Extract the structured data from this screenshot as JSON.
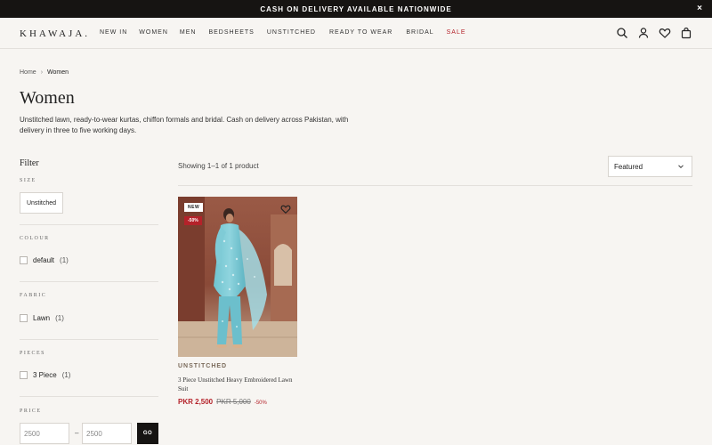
{
  "announcement": {
    "text": "CASH ON DELIVERY AVAILABLE NATIONWIDE",
    "close": "×"
  },
  "header": {
    "logo": "KHAWAJA.",
    "nav": [
      "NEW IN",
      "WOMEN",
      "MEN",
      "BEDSHEETS",
      "UNSTITCHED",
      "READY TO WEAR",
      "BRIDAL",
      "SALE"
    ],
    "icons": [
      "search-icon",
      "account-icon",
      "heart-icon",
      "bag-icon"
    ]
  },
  "breadcrumb": {
    "home": "Home",
    "current": "Women"
  },
  "page": {
    "title": "Women",
    "description": "Unstitched lawn, ready-to-wear kurtas, chiffon formals and bridal. Cash on delivery across Pakistan, with delivery in three to five working days."
  },
  "filter": {
    "title": "Filter",
    "size": {
      "label": "SIZE",
      "chip": "Unstitched"
    },
    "colour": {
      "label": "COLOUR",
      "option": "default",
      "count": "(1)"
    },
    "fabric": {
      "label": "FABRIC",
      "option": "Lawn",
      "count": "(1)"
    },
    "pieces": {
      "label": "PIECES",
      "option": "3 Piece",
      "count": "(1)"
    },
    "price": {
      "label": "PRICE",
      "min_placeholder": "2500",
      "max_placeholder": "2500",
      "dash": "–",
      "go": "GO"
    }
  },
  "results": {
    "showing": "Showing 1–1 of 1 product",
    "sort": "Featured"
  },
  "product": {
    "badge_new": "NEW",
    "badge_off": "-50%",
    "category": "UNSTITCHED",
    "name": "3 Piece Unstitched Heavy Embroidered Lawn Suit",
    "price_now": "PKR 2,500",
    "price_was": "PKR 5,000",
    "discount": "-50%"
  },
  "colors": {
    "accent_red": "#b4222a",
    "dark": "#161412",
    "background": "#f7f5f2"
  }
}
